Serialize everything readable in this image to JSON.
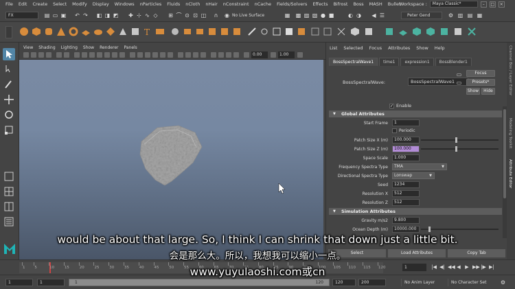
{
  "menubar": {
    "items": [
      "File",
      "Edit",
      "Create",
      "Select",
      "Modify",
      "Display",
      "Windows",
      "nParticles",
      "Fluids",
      "nCloth",
      "nHair",
      "nConstraint",
      "nCache",
      "Fields/Solvers",
      "Effects",
      "Bifrost",
      "Boss",
      "MASH",
      "Bullet"
    ],
    "workspace_label": "Workspace :",
    "workspace_value": "Maya Classic*",
    "window_buttons": [
      "–",
      "□",
      "×"
    ]
  },
  "statusline": {
    "mode": "FX",
    "live_surface": "No Live Surface",
    "user": "Peter Gend"
  },
  "viewport": {
    "menu": [
      "View",
      "Shading",
      "Lighting",
      "Show",
      "Renderer",
      "Panels"
    ],
    "field1": "0.00",
    "field2": "1.00"
  },
  "attribute_editor": {
    "menu": [
      "List",
      "Selected",
      "Focus",
      "Attributes",
      "Show",
      "Help"
    ],
    "tabs": [
      "BossSpectralWave1",
      "time1",
      "expression1",
      "BossBlender1"
    ],
    "node_label": "BossSpectralWave:",
    "node_name": "BossSpectralWave1",
    "buttons": {
      "focus": "Focus",
      "presets": "Presets*",
      "show": "Show",
      "hide": "Hide"
    },
    "enable_label": "Enable",
    "sections": {
      "global": "Global Attributes",
      "simulation": "Simulation Attributes"
    },
    "attrs": {
      "start_frame": {
        "label": "Start Frame",
        "value": "1"
      },
      "periodic": {
        "label": "Periodic"
      },
      "patch_x": {
        "label": "Patch Size X (m)",
        "value": "100.000",
        "slider": 0.45
      },
      "patch_z": {
        "label": "Patch Size Z (m)",
        "value": "100.000",
        "slider": 0.45
      },
      "space_scale": {
        "label": "Space Scale",
        "value": "1.000"
      },
      "freq_type": {
        "label": "Frequency Spectra Type",
        "value": "TMA"
      },
      "dir_type": {
        "label": "Directional Spectra Type",
        "value": "Lonswap"
      },
      "seed": {
        "label": "Seed",
        "value": "1234"
      },
      "res_x": {
        "label": "Resolution X",
        "value": "512"
      },
      "res_z": {
        "label": "Resolution Z",
        "value": "512"
      },
      "gravity": {
        "label": "Gravity m/s2",
        "value": "9.800"
      },
      "ocean_depth": {
        "label": "Ocean Depth (m)",
        "value": "10000.000",
        "slider": 0.1
      }
    },
    "bottom": {
      "select": "Select",
      "load": "Load Attributes",
      "copy": "Copy Tab"
    }
  },
  "right_tabs": [
    "Channel Box / Layer Editor",
    "Modeling Toolkit",
    "Attribute Editor"
  ],
  "timeline": {
    "ticks": [
      "1",
      "5",
      "10",
      "15",
      "20",
      "25",
      "30",
      "35",
      "40",
      "45",
      "50",
      "55",
      "60",
      "65",
      "70",
      "75",
      "80",
      "85",
      "90",
      "95",
      "100",
      "105",
      "110",
      "115",
      "120"
    ],
    "current_frame": "1",
    "playback": [
      "|◀",
      "◀|",
      "◀◀",
      "◀",
      "▶",
      "▶▶",
      "|▶",
      "▶|"
    ]
  },
  "range": {
    "start": "1",
    "anim_start": "1",
    "range_start": "1",
    "range_end": "120",
    "anim_end_a": "120",
    "anim_end_b": "200",
    "anim_layer": "No Anim Layer",
    "char_set": "No Character Set"
  },
  "subtitles": {
    "en": "would be about that large. So, I think I can shrink that down just a little bit.",
    "cn": "会是那么大。所以，我想我可以缩小一点。",
    "url": "www.yuyulaoshi.com或cn"
  },
  "colors": {
    "accent": "#5285a6",
    "highlight_field": "#b28cd6",
    "viewport_top": "#7a8aa3",
    "viewport_bottom": "#4a5668"
  }
}
